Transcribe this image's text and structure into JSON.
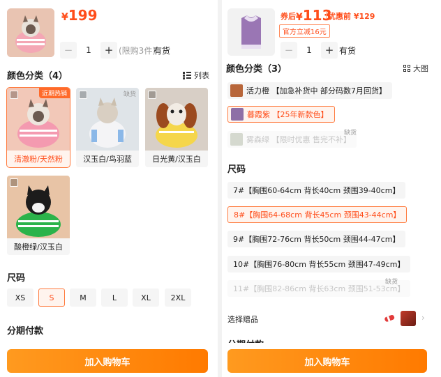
{
  "left": {
    "price": {
      "currency": "¥",
      "amount": "199"
    },
    "stepper": {
      "minus": "−",
      "value": "1",
      "plus": "+"
    },
    "limit_text": "(限购3件)",
    "availability": "有货",
    "color_section": {
      "title": "颜色分类（4）",
      "view_toggle": "列表"
    },
    "colors": [
      {
        "label": "清澈粉/天然粉",
        "badge": "近期热销",
        "selected": true
      },
      {
        "label": "汉玉白/鸟羽蓝",
        "badge": "缺货",
        "selected": false
      },
      {
        "label": "日光黄/汉玉白",
        "badge": "",
        "selected": false
      },
      {
        "label": "酸橙绿/汉玉白",
        "badge": "",
        "selected": false
      }
    ],
    "size_section": {
      "title": "尺码"
    },
    "sizes": [
      {
        "label": "XS",
        "selected": false
      },
      {
        "label": "S",
        "selected": true
      },
      {
        "label": "M",
        "selected": false
      },
      {
        "label": "L",
        "selected": false
      },
      {
        "label": "XL",
        "selected": false
      },
      {
        "label": "2XL",
        "selected": false
      }
    ],
    "installment_title": "分期付款",
    "cart_button": "加入购物车"
  },
  "right": {
    "coupon_prefix": "券后",
    "price": {
      "currency": "¥",
      "amount": "113"
    },
    "before_label": "优惠前 ¥129",
    "coupon_badge": "官方立减16元",
    "stepper": {
      "minus": "−",
      "value": "1",
      "plus": "+"
    },
    "availability": "有货",
    "color_section": {
      "title": "颜色分类（3）",
      "view_toggle": "大图"
    },
    "colors": [
      {
        "label": "活力橙 【加急补货中 部分码数7月回货】",
        "state": "normal",
        "swatch": "#b8663a"
      },
      {
        "label": "暮霞紫 【25年新款色】",
        "state": "selected",
        "swatch": "#8e6fa6"
      },
      {
        "label": "雾森绿 【限时优惠 售完不补】",
        "state": "disabled",
        "swatch": "#d5d9cf",
        "badge": "缺货"
      }
    ],
    "size_section": {
      "title": "尺码"
    },
    "sizes": [
      {
        "label": "7#【胸围60-64cm 背长40cm 颈围39-40cm】",
        "state": "normal"
      },
      {
        "label": "8#【胸围64-68cm 背长45cm 颈围43-44cm】",
        "state": "selected"
      },
      {
        "label": "9#【胸围72-76cm 背长50cm 颈围44-47cm】",
        "state": "normal"
      },
      {
        "label": "10#【胸围76-80cm 背长55cm 颈围47-49cm】",
        "state": "normal"
      },
      {
        "label": "11#【胸围82-86cm 背长63cm 颈围51-53cm】",
        "state": "disabled",
        "badge": "缺货"
      }
    ],
    "gift_label": "选择赠品",
    "installment_title": "分期付款",
    "cart_button": "加入购物车"
  },
  "colors": {
    "accent": "#ff4d1a",
    "button": "#ff8a00"
  }
}
